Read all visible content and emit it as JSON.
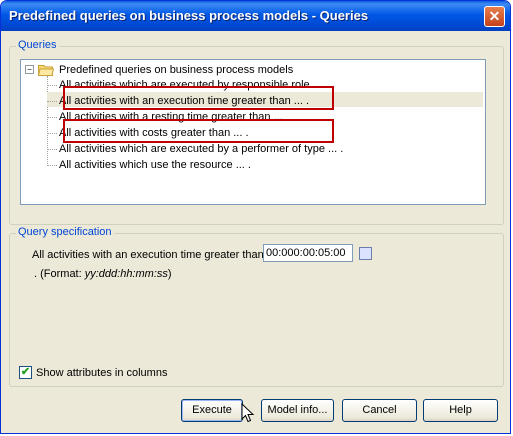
{
  "window": {
    "title": "Predefined queries on business process models - Queries",
    "close_symbol": "✕"
  },
  "queries_group": {
    "legend": "Queries",
    "tree": {
      "root_label": "Predefined queries on business process models",
      "expander_symbol": "⊟",
      "items": [
        "All activities which are executed by responsible role ...",
        "All activities with an execution time greater than ... .",
        "All activities with a resting time greater than ...",
        "All activities with costs greater than ... .",
        "All activities which are executed by a performer of type ... .",
        "All activities which use the resource ... ."
      ],
      "selected_index": 1
    }
  },
  "spec_group": {
    "legend": "Query specification",
    "label": "All activities with an execution time greater than",
    "value": "00:000:00:05:00",
    "format_prefix": ". (Format: ",
    "format_value": "yy:ddd:hh:mm:ss",
    "format_suffix": ")"
  },
  "show_attributes": {
    "label": "Show attributes in columns",
    "checked": true,
    "check_symbol": "✔"
  },
  "buttons": {
    "execute": "Execute",
    "model_info": "Model info...",
    "cancel": "Cancel",
    "help": "Help"
  },
  "colors": {
    "highlight_border": "#c00000",
    "title_bar": "#0058e6",
    "legend_text": "#0046d5"
  }
}
